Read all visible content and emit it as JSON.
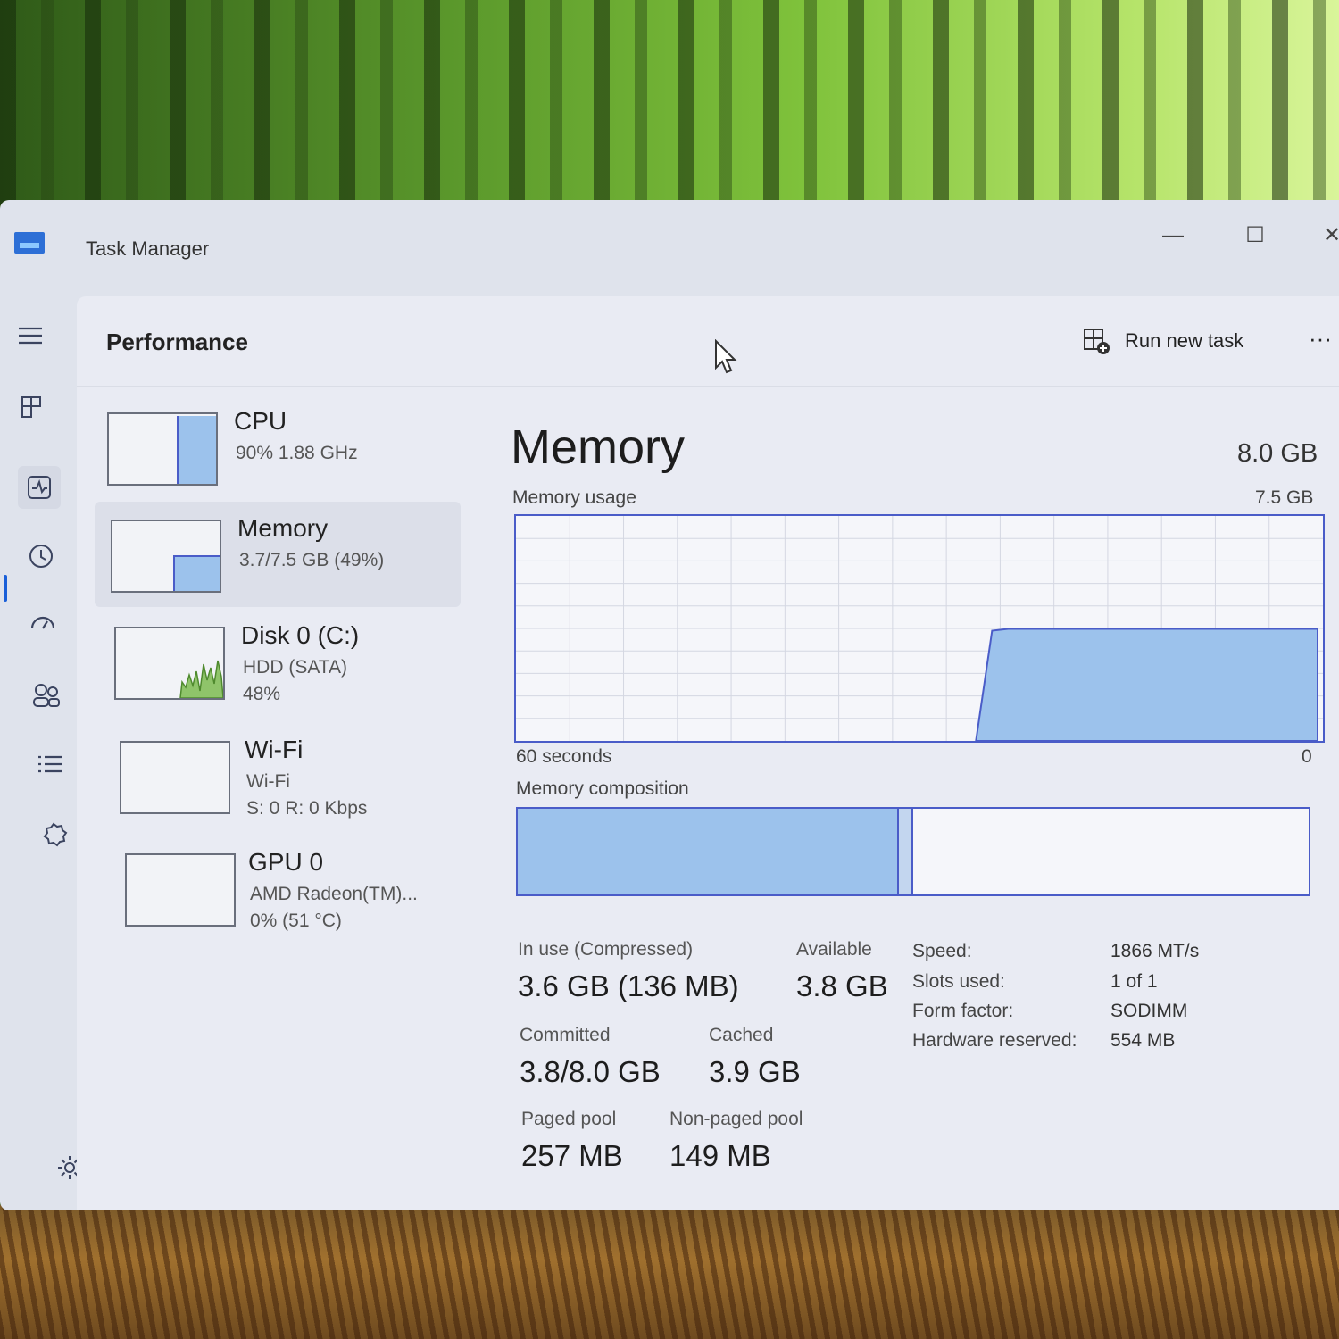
{
  "window": {
    "title": "Task Manager",
    "controls": {
      "minimize": "—",
      "maximize": "☐",
      "close": "✕"
    }
  },
  "header": {
    "title": "Performance",
    "run_new_task": "Run new task",
    "more": "···"
  },
  "nav_icons": [
    "hamburger-icon",
    "processes-icon",
    "performance-icon",
    "app-history-icon",
    "startup-apps-icon",
    "users-icon",
    "details-icon",
    "services-icon",
    "settings-icon"
  ],
  "perf_list": [
    {
      "name": "CPU",
      "sub1": "90%  1.88 GHz",
      "sub2": "",
      "usage": 0.9
    },
    {
      "name": "Memory",
      "sub1": "3.7/7.5 GB (49%)",
      "sub2": "",
      "usage": 0.49
    },
    {
      "name": "Disk 0 (C:)",
      "sub1": "HDD (SATA)",
      "sub2": "48%",
      "usage": 0.48
    },
    {
      "name": "Wi-Fi",
      "sub1": "Wi-Fi",
      "sub2": "S: 0 R: 0 Kbps",
      "usage": 0
    },
    {
      "name": "GPU 0",
      "sub1": "AMD Radeon(TM)...",
      "sub2": "0% (51 °C)",
      "usage": 0
    }
  ],
  "memory": {
    "title": "Memory",
    "total": "8.0 GB",
    "usage_label": "Memory usage",
    "usage_max": "7.5 GB",
    "axis_left": "60 seconds",
    "axis_right": "0",
    "composition_label": "Memory composition",
    "composition": {
      "in_use": 0.48,
      "modified": 0.016
    },
    "stats": {
      "in_use_label": "In use (Compressed)",
      "in_use_value": "3.6 GB (136 MB)",
      "available_label": "Available",
      "available_value": "3.8 GB",
      "committed_label": "Committed",
      "committed_value": "3.8/8.0 GB",
      "cached_label": "Cached",
      "cached_value": "3.9 GB",
      "paged_label": "Paged pool",
      "paged_value": "257 MB",
      "nonpaged_label": "Non-paged pool",
      "nonpaged_value": "149 MB"
    },
    "specs": [
      {
        "key": "Speed:",
        "value": "1866 MT/s"
      },
      {
        "key": "Slots used:",
        "value": "1 of 1"
      },
      {
        "key": "Form factor:",
        "value": "SODIMM"
      },
      {
        "key": "Hardware reserved:",
        "value": "554 MB"
      }
    ]
  },
  "colors": {
    "accent": "#1a5fd8",
    "graph_fill": "#9cc2ec",
    "graph_border": "#4a5cc8",
    "disk_fill": "#8fc46a"
  }
}
